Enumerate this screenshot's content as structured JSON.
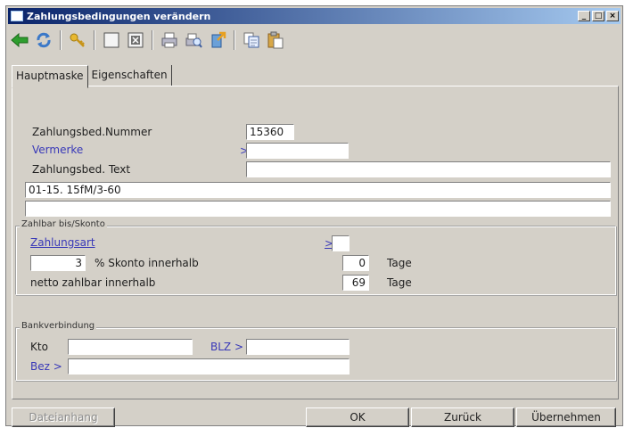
{
  "window": {
    "title": "Zahlungsbedingungen verändern",
    "controls": [
      "_",
      "□",
      "×"
    ]
  },
  "toolbar": {
    "icons": [
      "back-arrow-icon",
      "refresh-icon",
      "key-icon",
      "blank-page-icon",
      "delete-icon",
      "print-icon",
      "print-preview-icon",
      "export-icon",
      "copy-icon",
      "paste-icon"
    ]
  },
  "tabs": [
    "Hauptmaske",
    "Eigenschaften"
  ],
  "fields": {
    "nummer_label": "Zahlungsbed.Nummer",
    "nummer_value": "15360",
    "vermerke_label": "Vermerke",
    "vermerke_arrow": ">",
    "vermerke_value": "",
    "text_label": "Zahlungsbed. Text",
    "text_value": "",
    "line1_value": "01-15. 15fM/3-60",
    "line2_value": ""
  },
  "zahlbar": {
    "group_title": "Zahlbar bis/Skonto",
    "zahlungsart_label": "Zahlungsart",
    "zahlungsart_arrow": ">",
    "zahlungsart_value": "",
    "skonto_percent": "3",
    "skonto_label": "% Skonto innerhalb",
    "skonto_days": "0",
    "skonto_unit": "Tage",
    "netto_label": "netto  zahlbar innerhalb",
    "netto_days": "69",
    "netto_unit": "Tage"
  },
  "bank": {
    "group_title": "Bankverbindung",
    "kto_label": "Kto",
    "kto_value": "",
    "blz_label": "BLZ >",
    "blz_value": "",
    "bez_label": "Bez >",
    "bez_value": ""
  },
  "buttons": {
    "dateianhang": "Dateianhang",
    "ok": "OK",
    "zurueck": "Zurück",
    "uebernehmen": "Übernehmen"
  }
}
